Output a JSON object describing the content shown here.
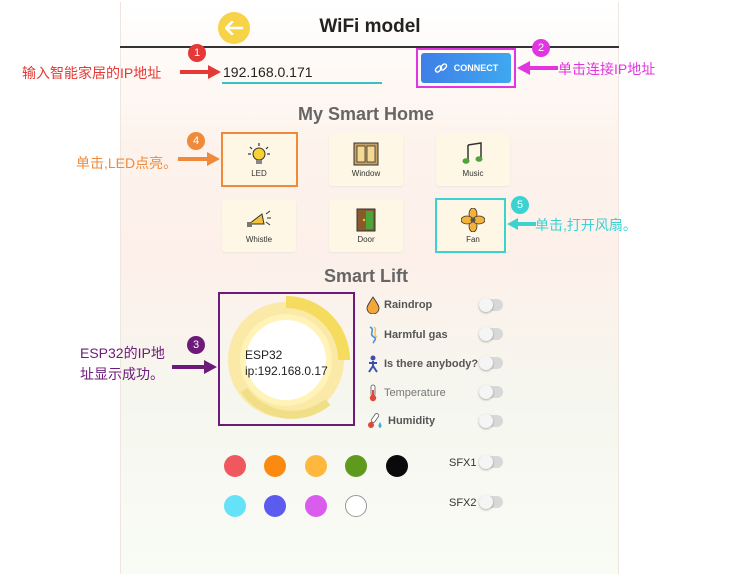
{
  "header": {
    "title": "WiFi model"
  },
  "connection": {
    "ip_value": "192.168.0.171",
    "connect_label": "CONNECT"
  },
  "home": {
    "title": "My Smart Home",
    "devices": [
      {
        "label": "LED",
        "icon": "light-bulb-icon"
      },
      {
        "label": "Window",
        "icon": "window-icon"
      },
      {
        "label": "Music",
        "icon": "music-note-icon"
      },
      {
        "label": "Whistle",
        "icon": "whistle-icon"
      },
      {
        "label": "Door",
        "icon": "door-icon"
      },
      {
        "label": "Fan",
        "icon": "fan-icon"
      }
    ]
  },
  "lift": {
    "title": "Smart Lift",
    "display_line1": "ESP32",
    "display_line2": "ip:192.168.0.17",
    "sensors": [
      {
        "label": "Raindrop",
        "icon": "raindrop-icon"
      },
      {
        "label": "Harmful gas",
        "icon": "gas-icon"
      },
      {
        "label": "Is there anybody?",
        "icon": "person-icon"
      },
      {
        "label": "Temperature",
        "icon": "thermometer-icon"
      },
      {
        "label": "Humidity",
        "icon": "humidity-icon"
      }
    ]
  },
  "colors": {
    "swatches": [
      "#f0585f",
      "#fc8a11",
      "#feb83e",
      "#5f9a1c",
      "#0a0a0a",
      "#66e2f8",
      "#5b5cef",
      "#da5cef",
      "#ffffff"
    ]
  },
  "sfx": {
    "sfx1": "SFX1",
    "sfx2": "SFX2"
  },
  "annotations": {
    "a1": "输入智能家居的IP地址",
    "a2": "单击连接IP地址",
    "a3_line1": "ESP32的IP地",
    "a3_line2": "址显示成功。",
    "a4": "单击,LED点亮。",
    "a5": "单击,打开风扇。",
    "badges": [
      "1",
      "2",
      "3",
      "4",
      "5"
    ]
  },
  "accent_colors": {
    "red": "#e53935",
    "magenta": "#e235e2",
    "orange": "#ef8a3a",
    "purple": "#6d1a7a",
    "cyan": "#3cd2d2"
  }
}
